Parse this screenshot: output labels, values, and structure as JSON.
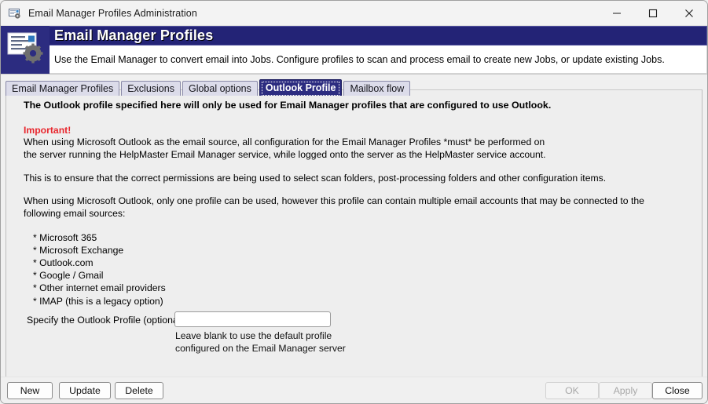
{
  "window": {
    "title": "Email Manager Profiles Administration",
    "icon": "email-settings-icon",
    "minimize_label": "Minimize",
    "maximize_label": "Maximize",
    "close_label": "Close"
  },
  "banner": {
    "icon": "email-profile-gear-icon",
    "title": "Email Manager Profiles",
    "description": "Use the Email Manager to convert email into Jobs.  Configure profiles to scan and process email to create new Jobs, or update existing Jobs.",
    "bg_color": "#2c2c80",
    "title_color": "#ffffff"
  },
  "tabs": [
    {
      "label": "Email Manager Profiles",
      "active": false
    },
    {
      "label": "Exclusions",
      "active": false
    },
    {
      "label": "Global options",
      "active": false
    },
    {
      "label": "Outlook Profile",
      "active": true
    },
    {
      "label": "Mailbox flow",
      "active": false
    }
  ],
  "content": {
    "lead": "The Outlook profile specified here will only be used for Email Manager profiles that are configured to use Outlook.",
    "important_label": "Important!",
    "important_color": "#e8262d",
    "important_body_line1": "When using Microsoft Outlook as the email source, all configuration for the Email Manager Profiles *must* be performed on",
    "important_body_line2": "the server running the HelpMaster Email Manager service, while logged onto the server as the HelpMaster service account.",
    "para2": "This is to ensure that the correct permissions are being used to select scan folders, post-processing folders and other configuration items.",
    "para3": "When using Microsoft Outlook, only one profile can be used, however this profile can contain multiple email accounts that may be connected to the following email sources:",
    "bullets": [
      "* Microsoft 365",
      "* Microsoft Exchange",
      "* Outlook.com",
      "* Google / Gmail",
      "* Other internet email providers",
      "* IMAP (this is a legacy option)"
    ]
  },
  "field": {
    "label": "Specify the Outlook Profile (optional)",
    "value": "",
    "placeholder": "",
    "hint_line1": "Leave blank to use the default profile",
    "hint_line2": "configured on the Email Manager server"
  },
  "buttons": {
    "left": [
      {
        "label": "New",
        "disabled": false
      },
      {
        "label": "Update",
        "disabled": false
      },
      {
        "label": "Delete",
        "disabled": false
      }
    ],
    "right": [
      {
        "label": "OK",
        "disabled": true
      },
      {
        "label": "Apply",
        "disabled": true
      },
      {
        "label": "Close",
        "disabled": false
      }
    ]
  }
}
